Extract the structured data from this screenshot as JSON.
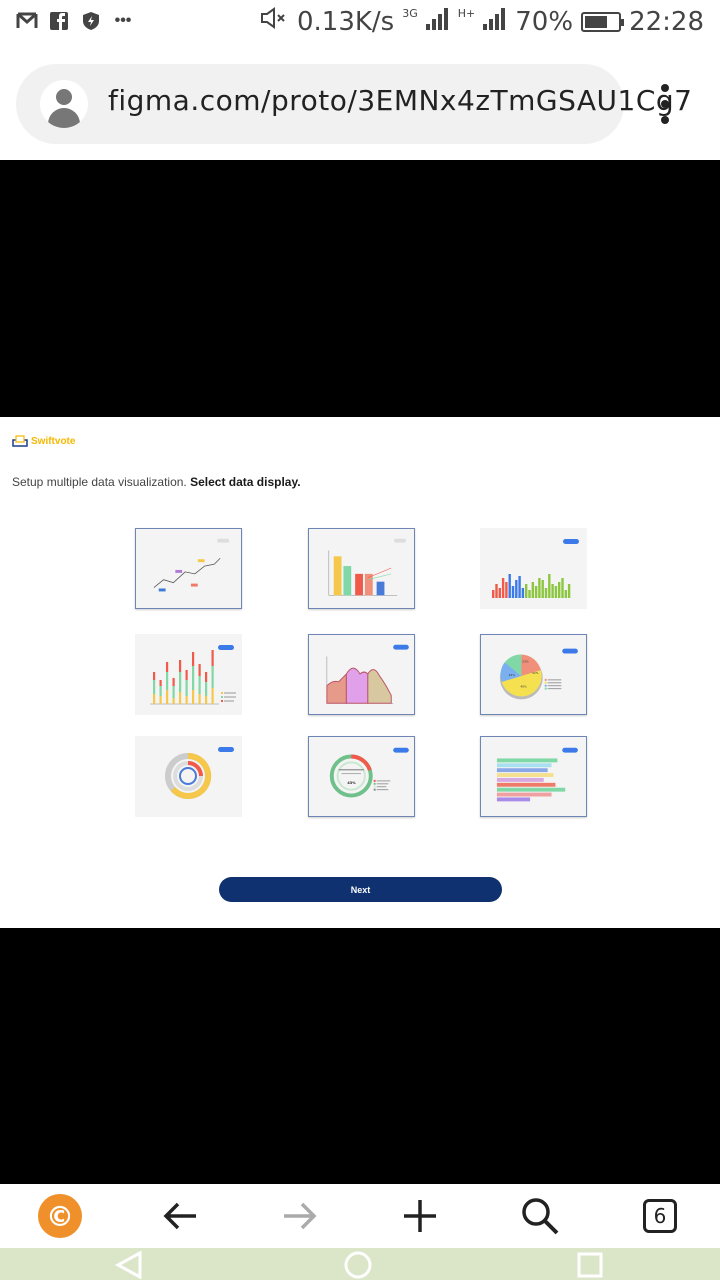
{
  "status_bar": {
    "net_speed": "0.13K/s",
    "signal_1": "3G",
    "signal_2": "H+",
    "battery": "70%",
    "battery_level": 0.7,
    "time": "22:28"
  },
  "address_bar": {
    "url": "figma.com/proto/3EMNx4zTmGSAU1Cg7"
  },
  "app": {
    "brand": "Swiftvote",
    "brand_color": "#f5b800",
    "heading_prefix": "Setup multiple data visualization. ",
    "heading_emphasis": "Select data display.",
    "next_label": "Next",
    "accent": "#0f3170"
  },
  "cards": [
    {
      "kind": "line-chart"
    },
    {
      "kind": "bar-chart"
    },
    {
      "kind": "histogram"
    },
    {
      "kind": "stacked-bar-chart"
    },
    {
      "kind": "area-chart"
    },
    {
      "kind": "pie-chart",
      "labels": [
        "23%",
        "32%",
        "45%",
        "45%"
      ]
    },
    {
      "kind": "radial-chart"
    },
    {
      "kind": "donut-chart",
      "center": "43%"
    },
    {
      "kind": "horizontal-bar-chart"
    }
  ],
  "toolbar": {
    "tab_count": "6",
    "icons": [
      "c-logo-icon",
      "back-arrow-icon",
      "forward-arrow-icon",
      "new-tab-icon",
      "search-icon",
      "tabs-icon"
    ]
  }
}
